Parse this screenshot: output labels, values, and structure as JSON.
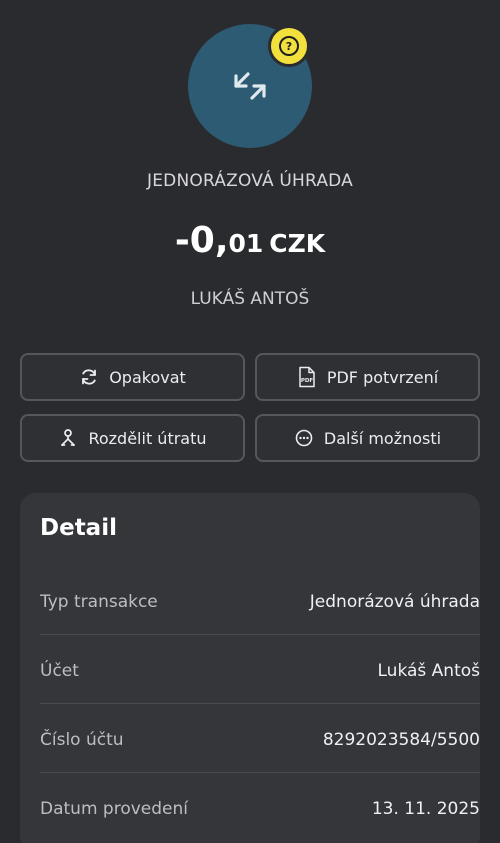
{
  "header": {
    "transaction_type": "JEDNORÁZOVÁ ÚHRADA",
    "amount_whole": "-0,",
    "amount_decimal": "01",
    "currency": "CZK",
    "counterparty": "LUKÁŠ ANTOŠ",
    "avatar_icon": "transfer-arrows-icon",
    "badge_icon": "question-icon",
    "badge_symbol": "?"
  },
  "actions": {
    "repeat": {
      "label": "Opakovat",
      "icon": "refresh-icon"
    },
    "pdf": {
      "label": "PDF potvrzení",
      "icon": "pdf-file-icon"
    },
    "split": {
      "label": "Rozdělit útratu",
      "icon": "split-person-icon"
    },
    "more": {
      "label": "Další možnosti",
      "icon": "more-dots-icon"
    }
  },
  "detail": {
    "title": "Detail",
    "rows": [
      {
        "label": "Typ transakce",
        "value": "Jednorázová úhrada"
      },
      {
        "label": "Účet",
        "value": "Lukáš Antoš"
      },
      {
        "label": "Číslo účtu",
        "value": "8292023584/5500"
      },
      {
        "label": "Datum provedení",
        "value": "13. 11. 2025"
      }
    ]
  },
  "colors": {
    "background": "#2a2b2f",
    "avatar": "#2c5b73",
    "badge": "#f2e13c",
    "card": "#35363a",
    "button_border": "#56575c"
  }
}
